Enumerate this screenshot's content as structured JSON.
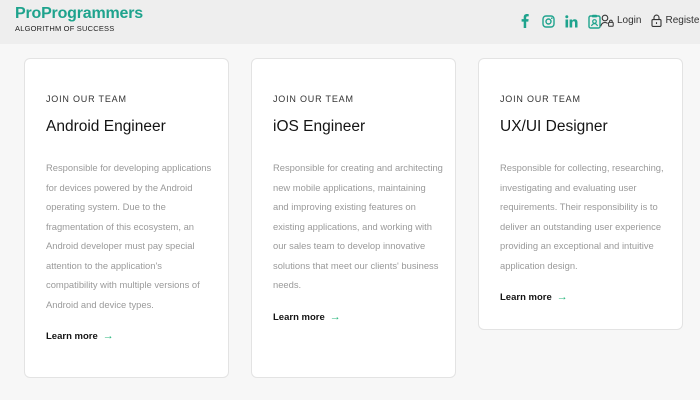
{
  "colors": {
    "brand": "#1ea38d",
    "accent_arrow": "#24b57a",
    "header_bg": "#eeeeee"
  },
  "header": {
    "brand_name": "ProProgrammers",
    "brand_tagline": "ALGORITHM OF SUCCESS",
    "social_icons": [
      "facebook-icon",
      "instagram-icon",
      "linkedin-icon",
      "clipboard-icon"
    ],
    "login_label": "Login",
    "register_label": "Register"
  },
  "cards": [
    {
      "kicker": "JOIN OUR TEAM",
      "title": "Android Engineer",
      "description": "Responsible for developing applications for devices powered by the Android operating system. Due to the fragmentation of this ecosystem, an Android developer must pay special attention to the application's compatibility with multiple versions of Android and device types.",
      "link": "Learn more"
    },
    {
      "kicker": "JOIN OUR TEAM",
      "title": "iOS Engineer",
      "description": "Responsible for creating and architecting new mobile applications, maintaining and improving existing features on existing applications, and working with our sales team to develop innovative solutions that meet our clients' business needs.",
      "link": "Learn more"
    },
    {
      "kicker": "JOIN OUR TEAM",
      "title": "UX/UI Designer",
      "description": "Responsible for collecting, researching, investigating and evaluating user requirements. Their responsibility is to deliver an outstanding user experience providing an exceptional and intuitive application design.",
      "link": "Learn more"
    }
  ]
}
